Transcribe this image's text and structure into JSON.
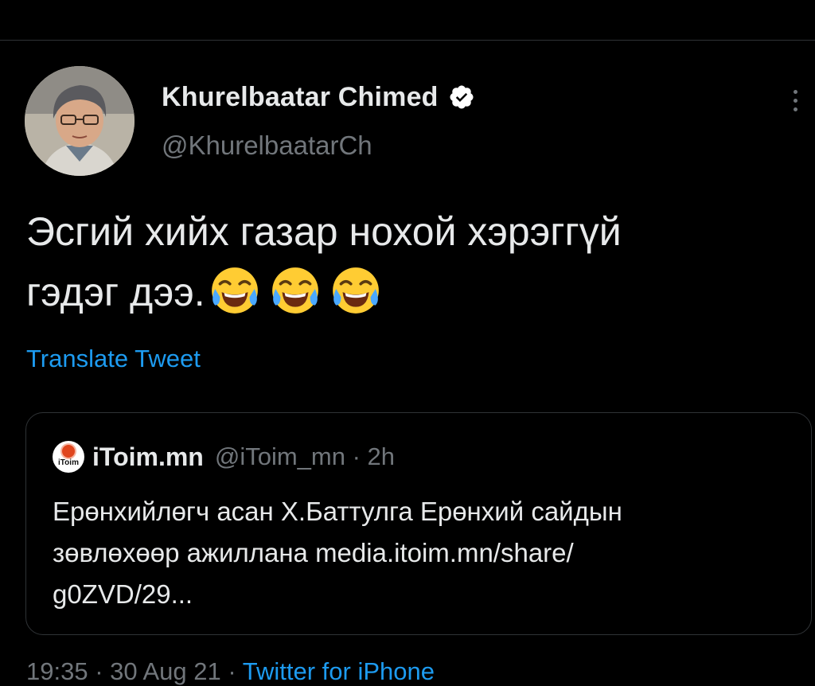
{
  "tweet": {
    "author": {
      "name": "Khurelbaatar Chimed",
      "handle": "@KhurelbaatarCh",
      "verified": true,
      "verified_icon": "verified-badge-icon"
    },
    "text_lines": [
      "Эсгий хийх газар нохой хэрэггүй",
      "гэдэг дээ."
    ],
    "emojis": [
      "😂",
      "😂",
      "😂"
    ],
    "translate_label": "Translate Tweet",
    "more_icon": "more-options-icon",
    "footer": {
      "time": "19:35 · 30 Aug 21 · ",
      "source": "Twitter for iPhone"
    }
  },
  "quote": {
    "avatar_label": "iToim",
    "name": "iToim.mn",
    "handle_time": "@iToim_mn · 2h",
    "text_lines": [
      "Ерөнхийлөгч асан Х.Баттулга Ерөнхий сайдын",
      "зөвлөхөөр ажиллана media.itoim.mn/share/",
      "g0ZVD/29..."
    ]
  },
  "colors": {
    "background": "#000000",
    "text_primary": "#e7e9ea",
    "text_secondary": "#71767b",
    "link": "#1d9bf0",
    "border": "#2f3336"
  }
}
